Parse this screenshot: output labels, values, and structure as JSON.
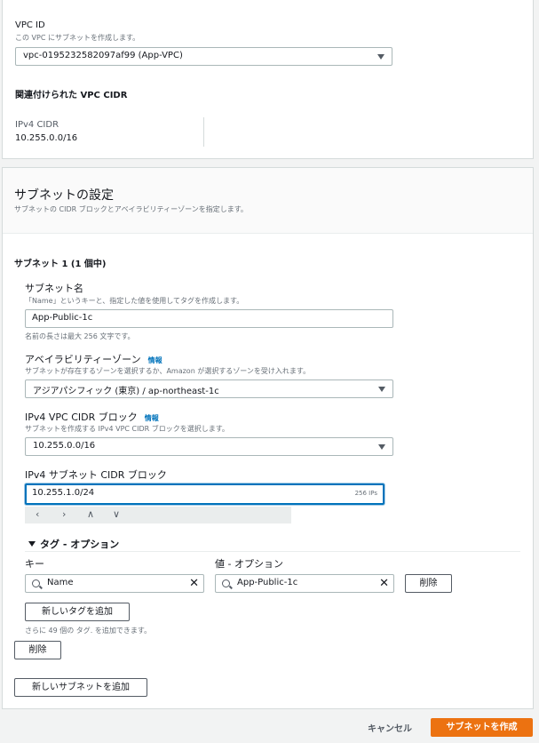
{
  "vpc": {
    "label": "VPC ID",
    "description": "この VPC にサブネットを作成します。",
    "selected": "vpc-0195232582097af99 (App-VPC)",
    "cidr_heading": "関連付けられた VPC CIDR",
    "ipv4_label": "IPv4 CIDR",
    "ipv4_value": "10.255.0.0/16"
  },
  "subnet_settings": {
    "title": "サブネットの設定",
    "description": "サブネットの CIDR ブロックとアベイラビリティーゾーンを指定します。",
    "subnet_heading": "サブネット 1 (1 個中)",
    "name": {
      "label": "サブネット名",
      "description": "「Name」というキーと、指定した値を使用してタグを作成します。",
      "value": "App-Public-1c",
      "hint": "名前の長さは最大 256 文字です。"
    },
    "az": {
      "label": "アベイラビリティーゾーン",
      "info": "情報",
      "description": "サブネットが存在するゾーンを選択するか、Amazon が選択するゾーンを受け入れます。",
      "selected": "アジアパシフィック (東京) / ap-northeast-1c"
    },
    "vpc_cidr": {
      "label": "IPv4 VPC CIDR ブロック",
      "info": "情報",
      "description": "サブネットを作成する IPv4 VPC CIDR ブロックを選択します。",
      "selected": "10.255.0.0/16"
    },
    "subnet_cidr": {
      "label": "IPv4 サブネット CIDR ブロック",
      "value": "10.255.1.0/24",
      "suffix": "256 IPs"
    },
    "cidr_nav": [
      "‹",
      "›",
      "∧",
      "∨"
    ],
    "tags": {
      "toggle": "タグ - オプション",
      "key_header": "キー",
      "value_header": "値 - オプション",
      "key_value": "Name",
      "value_value": "App-Public-1c",
      "remove_label": "削除",
      "add_tag_label": "新しいタグを追加",
      "remaining_hint": "さらに 49 個の タグ. を追加できます。"
    },
    "remove_subnet_label": "削除",
    "add_subnet_label": "新しいサブネットを追加"
  },
  "footer": {
    "cancel_label": "キャンセル",
    "create_label": "サブネットを作成"
  },
  "colors": {
    "primary": "#ec7211",
    "focus": "#0073bb",
    "info_link": "#0073bb"
  }
}
